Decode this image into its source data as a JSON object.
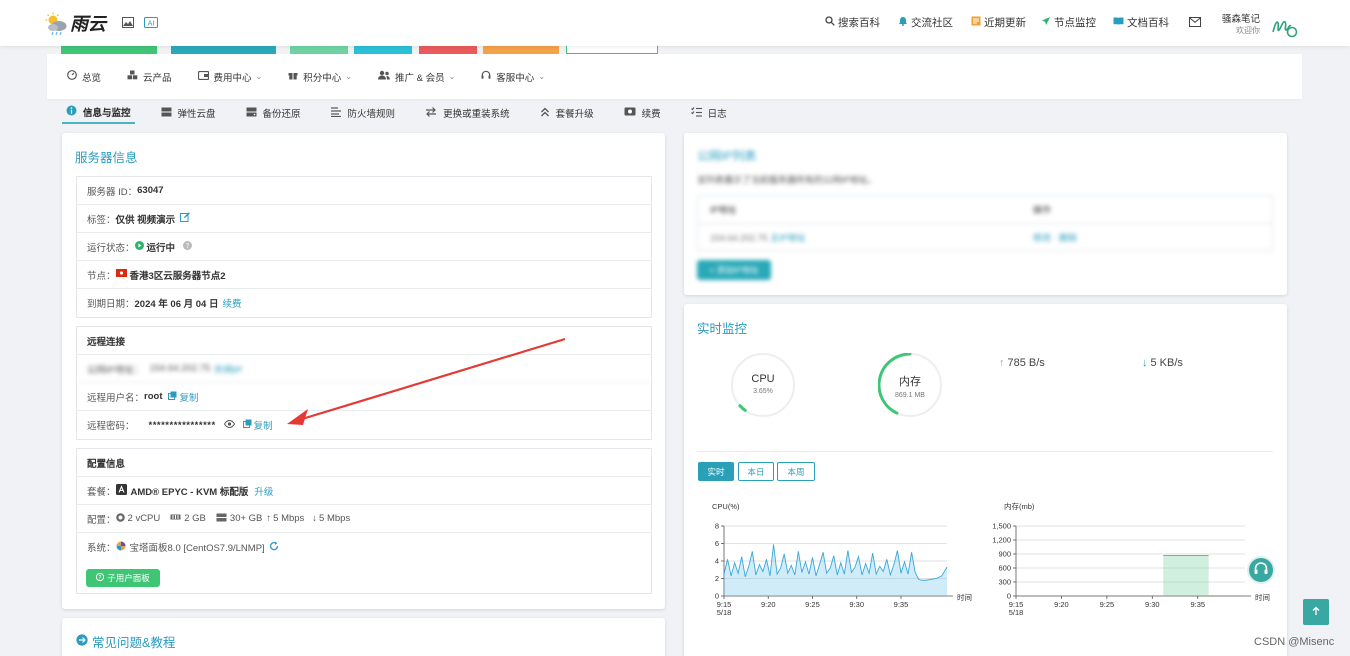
{
  "header": {
    "brand": "雨云",
    "nav": [
      {
        "icon": "search-icon",
        "label": "搜索百科"
      },
      {
        "icon": "bell-icon",
        "label": "交流社区"
      },
      {
        "icon": "news-icon",
        "label": "近期更新"
      },
      {
        "icon": "send-icon",
        "label": "节点监控"
      },
      {
        "icon": "book-icon",
        "label": "文档百科"
      }
    ],
    "user_name": "骚森笔记",
    "user_welcome": "欢迎你"
  },
  "menu": [
    "总览",
    "云产品",
    "费用中心",
    "积分中心",
    "推广 & 会员",
    "客服中心"
  ],
  "tabs": [
    "信息与监控",
    "弹性云盘",
    "备份还原",
    "防火墙规则",
    "更换或重装系统",
    "套餐升级",
    "续费",
    "日志"
  ],
  "server": {
    "title": "服务器信息",
    "id_label": "服务器 ID：",
    "id_value": "63047",
    "tag_label": "标签：",
    "tag_value": "仅供 视频演示",
    "status_label": "运行状态：",
    "status_value": "运行中",
    "node_label": "节点：",
    "node_value": "香港3区云服务器节点2",
    "expire_label": "到期日期：",
    "expire_value": "2024 年 06 月 04 日",
    "renew_link": "续费"
  },
  "remote": {
    "heading": "远程连接",
    "addr_label": "公网IP地址：",
    "addr_value": "154.64.202.75",
    "addr_link": "外网IP",
    "user_label": "远程用户名：",
    "user_value": "root",
    "pwd_label": "远程密码：",
    "pwd_value": "****************",
    "copy_label": "复制"
  },
  "config": {
    "heading": "配置信息",
    "plan_label": "套餐：",
    "plan_value": "AMD® EPYC - KVM 标配版",
    "upgrade_link": "升级",
    "spec_label": "配置：",
    "cpu": "2 vCPU",
    "ram": "2 GB",
    "disk": "30+ GB",
    "up": "5 Mbps",
    "down": "5 Mbps",
    "sys_label": "系统：",
    "sys_value": "宝塔面板8.0 [CentOS7.9/LNMP]",
    "panel_button": "子用户面板"
  },
  "faq": {
    "title": "常见问题&教程"
  },
  "ipcard": {
    "title": "公网IP列表",
    "desc": "该列表展示了当前服务器所有的公网IP地址。",
    "col1": "IP地址",
    "col2": "操作",
    "ip": "154.64.202.75",
    "ip_tag": "主IP地址",
    "ops": "修改 · 删除",
    "button": "+ 添加IP地址"
  },
  "monitor": {
    "title": "实时监控",
    "cpu_label": "CPU",
    "cpu_value": "3.65%",
    "cpu_fraction": 0.0365,
    "mem_label": "内存",
    "mem_value": "869.1 MB",
    "mem_fraction": 0.43,
    "net_up": "785 B/s",
    "net_down": "5 KB/s",
    "ranges": [
      "实时",
      "本日",
      "本周"
    ]
  },
  "chart_data": [
    {
      "type": "area",
      "ylabel": "CPU(%)",
      "xlabel": "时间",
      "ylim": [
        0,
        8
      ],
      "yticks": [
        0,
        2,
        4,
        6,
        8
      ],
      "xticks": [
        "9:15\n5/18",
        "9:20",
        "9:25",
        "9:30",
        "9:35"
      ],
      "x_minutes": [
        0,
        0.4,
        0.8,
        1.2,
        1.6,
        2.0,
        2.4,
        2.8,
        3.2,
        3.6,
        4.0,
        4.4,
        4.8,
        5.2,
        5.6,
        6.0,
        6.4,
        6.8,
        7.2,
        7.6,
        8.0,
        8.4,
        8.8,
        9.2,
        9.6,
        10.0,
        10.4,
        10.8,
        11.2,
        11.6,
        12.0,
        12.4,
        12.8,
        13.2,
        13.6,
        14.0,
        14.4,
        14.8,
        15.2,
        15.6,
        16.0,
        16.4,
        16.8,
        17.2,
        17.6,
        18.0,
        18.4,
        18.8,
        19.2,
        19.6,
        20.0,
        20.4,
        20.8,
        21.2,
        21.6,
        22.0,
        22.4,
        22.8,
        23.4,
        24.0,
        24.6,
        25.2
      ],
      "values": [
        2.5,
        4.2,
        2.3,
        3.8,
        2.6,
        4.5,
        2.2,
        3.4,
        5.1,
        2.4,
        3.6,
        2.8,
        4.2,
        2.3,
        5.9,
        2.5,
        3.2,
        4.8,
        2.6,
        3.5,
        2.4,
        5.1,
        2.7,
        3.9,
        2.5,
        4.4,
        2.3,
        3.6,
        5.0,
        2.6,
        3.2,
        4.6,
        2.4,
        3.8,
        2.5,
        5.2,
        2.7,
        3.3,
        4.5,
        2.4,
        3.7,
        2.6,
        4.9,
        2.5,
        3.4,
        2.8,
        4.2,
        2.4,
        3.6,
        5.2,
        2.6,
        3.9,
        2.5,
        5.0,
        2.7,
        1.9,
        1.8,
        1.8,
        1.9,
        2.0,
        2.3,
        3.3
      ]
    },
    {
      "type": "area",
      "ylabel": "内存(mb)",
      "xlabel": "时间",
      "ylim": [
        0,
        1500
      ],
      "yticks": [
        0,
        300,
        600,
        900,
        1200,
        1500
      ],
      "xticks": [
        "9:15\n5/18",
        "9:20",
        "9:25",
        "9:30",
        "9:35"
      ],
      "x_minutes": [
        16.2,
        21.2
      ],
      "values": [
        869,
        869
      ]
    }
  ],
  "colors": {
    "accent": "#2a9cbf",
    "green": "#3ec675",
    "teal": "#3aa8a2"
  },
  "footer_watermark": "CSDN @Misenc"
}
